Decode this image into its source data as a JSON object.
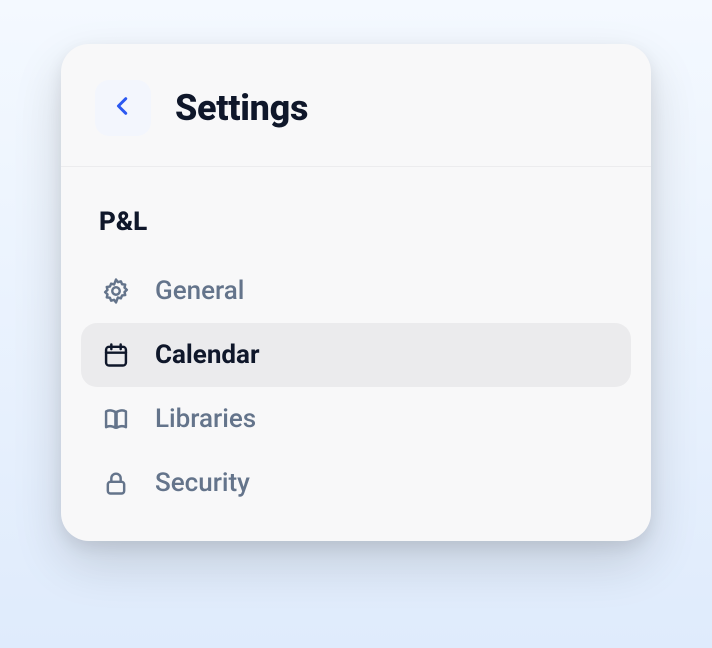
{
  "header": {
    "title": "Settings"
  },
  "section": {
    "heading": "P&L",
    "items": [
      {
        "label": "General",
        "selected": false
      },
      {
        "label": "Calendar",
        "selected": true
      },
      {
        "label": "Libraries",
        "selected": false
      },
      {
        "label": "Security",
        "selected": false
      }
    ]
  }
}
